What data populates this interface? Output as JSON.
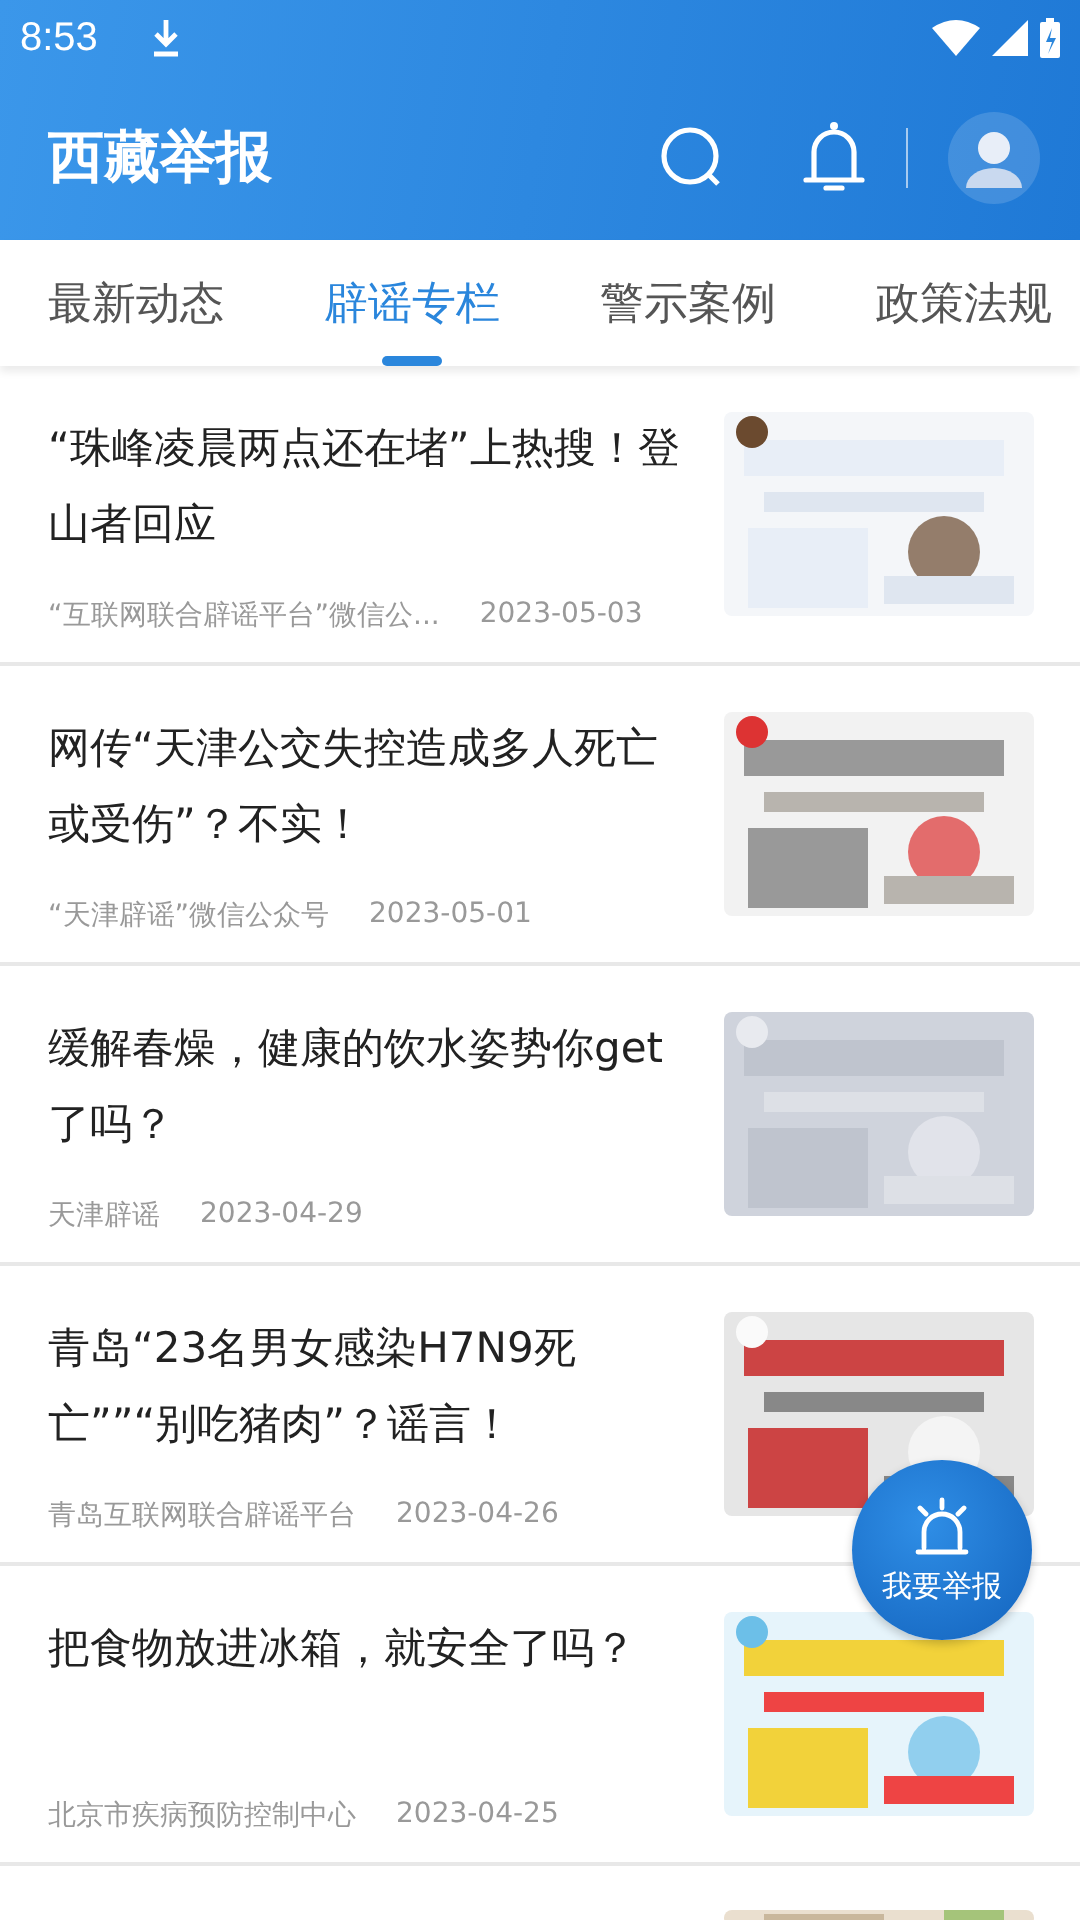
{
  "status_bar": {
    "time": "8:53"
  },
  "header": {
    "title": "西藏举报"
  },
  "tabs": [
    {
      "label": "最新动态",
      "selected": false
    },
    {
      "label": "辟谣专栏",
      "selected": true
    },
    {
      "label": "警示案例",
      "selected": false
    },
    {
      "label": "政策法规",
      "selected": false
    }
  ],
  "articles": [
    {
      "title": "“珠峰凌晨两点还在堵”上热搜！登山者回应",
      "source": "“互联网联合辟谣平台”微信公...",
      "date": "2023-05-03"
    },
    {
      "title": "网传“天津公交失控造成多人死亡或受伤”？不实！",
      "source": "“天津辟谣”微信公众号",
      "date": "2023-05-01"
    },
    {
      "title": "缓解春燥，健康的饮水姿势你get了吗？",
      "source": "天津辟谣",
      "date": "2023-04-29"
    },
    {
      "title": "青岛“23名男女感染H7N9死亡””“别吃猪肉”？谣言！",
      "source": "青岛互联网联合辟谣平台",
      "date": "2023-04-26"
    },
    {
      "title": "把食物放进冰箱，就安全了吗？",
      "source": "北京市疾病预防控制中心",
      "date": "2023-04-25"
    }
  ],
  "report_button": {
    "label": "我要举报"
  }
}
